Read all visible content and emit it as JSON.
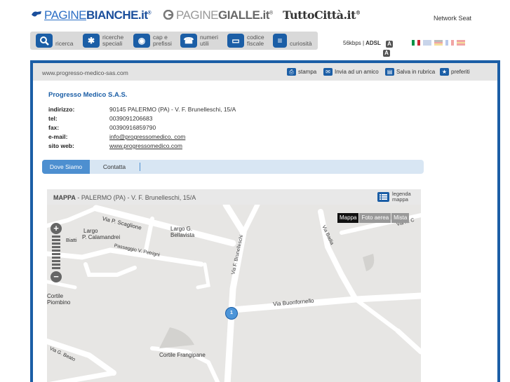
{
  "brands": {
    "paginebianche_prefix": "PAGINE",
    "paginebianche_main": "BIANCHE.it",
    "paginegialle_prefix": "PAGINE",
    "paginegialle_main": "GIALLE.it",
    "tuttocitta": "TuttoCittà.it",
    "registered": "®",
    "network": "Network Seat"
  },
  "nav": [
    {
      "label": "ricerca",
      "icon": "search-icon"
    },
    {
      "label": "ricerche speciali",
      "icon": "puzzle-icon"
    },
    {
      "label": "cap e prefissi",
      "icon": "globe-icon"
    },
    {
      "label": "numeri utili",
      "icon": "phone-icon"
    },
    {
      "label": "codice fiscale",
      "icon": "card-icon"
    },
    {
      "label": "curiosità",
      "icon": "list-icon"
    }
  ],
  "speed": {
    "kbps": "56kbps",
    "adsl": "ADSL",
    "badge": "A"
  },
  "url": "www.progresso-medico-sas.com",
  "actions": {
    "print": "stampa",
    "send": "Invia ad un amico",
    "save": "Salva in rubrica",
    "favorites": "preferiti"
  },
  "company": {
    "name": "Progresso Medico S.A.S.",
    "rows": [
      {
        "label": "indirizzo:",
        "value": "90145 PALERMO (PA) - V. F. Brunelleschi, 15/A"
      },
      {
        "label": "tel:",
        "value": "0039091206683"
      },
      {
        "label": "fax:",
        "value": "0039091685979​0"
      },
      {
        "label": "e-mail:",
        "value": "info@progressomedico. com"
      },
      {
        "label": "sito web:",
        "value": "www.progressomedico.com"
      }
    ]
  },
  "tabs": {
    "active": "Dove Siamo",
    "second": "Contatta"
  },
  "map": {
    "title": "MAPPA",
    "subtitle": " - PALERMO (PA) - V. F. Brunelleschi, 15/A",
    "legend": "legenda mappa",
    "types": [
      "Mappa",
      "Foto aerea",
      "Mista"
    ],
    "marker": "1",
    "labels": {
      "scaglione": "Via P. Scaglione",
      "largo_cal_1": "Largo",
      "largo_cal_2": "P. Calamandrei",
      "largo_bel_1": "Largo G.",
      "largo_bel_2": "Bellavista",
      "petrigni": "Passaggio V. Petrigni",
      "brunelleschi": "Via F. Brunelleschi",
      "badia": "Via Badia",
      "buonfornello": "Via Buonfornello",
      "cortile_p1": "Cortile",
      "cortile_p2": "Piombino",
      "frangipane": "Cortile Frangipane",
      "beato": "Via G. Beato",
      "biatti": "Biatti",
      "via_n": "Via N. C"
    }
  },
  "colors": {
    "brand_blue": "#1b5ea6",
    "tab_active": "#4d8fd0",
    "tab_bg": "#d8e6f3"
  }
}
